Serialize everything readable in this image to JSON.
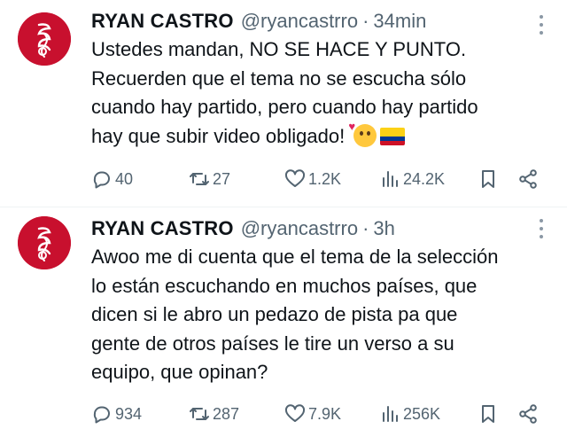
{
  "tweets": [
    {
      "author_name": "RYAN CASTRO",
      "handle": "@ryancastrro",
      "separator": "·",
      "time": "34min",
      "text": "Ustedes mandan, NO SE HACE Y PUNTO.\nRecuerden que el tema no se escucha sólo\ncuando hay partido, pero cuando hay partido\nhay que subir video obligado!",
      "emojis": [
        "smiling-face-with-hearts",
        "colombia-flag"
      ],
      "replies": "40",
      "reposts": "27",
      "likes": "1.2K",
      "views": "24.2K"
    },
    {
      "author_name": "RYAN CASTRO",
      "handle": "@ryancastrro",
      "separator": "·",
      "time": "3h",
      "text": "Awoo me di cuenta que el tema de la selección\nlo están escuchando en muchos países, que\ndicen si le abro un pedazo de pista pa que\ngente de otros países le tire un verso a su\nequipo, que opinan?",
      "replies": "934",
      "reposts": "287",
      "likes": "7.9K",
      "views": "256K"
    }
  ],
  "colors": {
    "text": "#0f1419",
    "secondary": "#536471",
    "avatar_bg": "#c8102e",
    "divider": "#eff3f4"
  },
  "icons": [
    "more-icon",
    "reply-icon",
    "repost-icon",
    "like-icon",
    "views-icon",
    "bookmark-icon",
    "share-icon"
  ]
}
